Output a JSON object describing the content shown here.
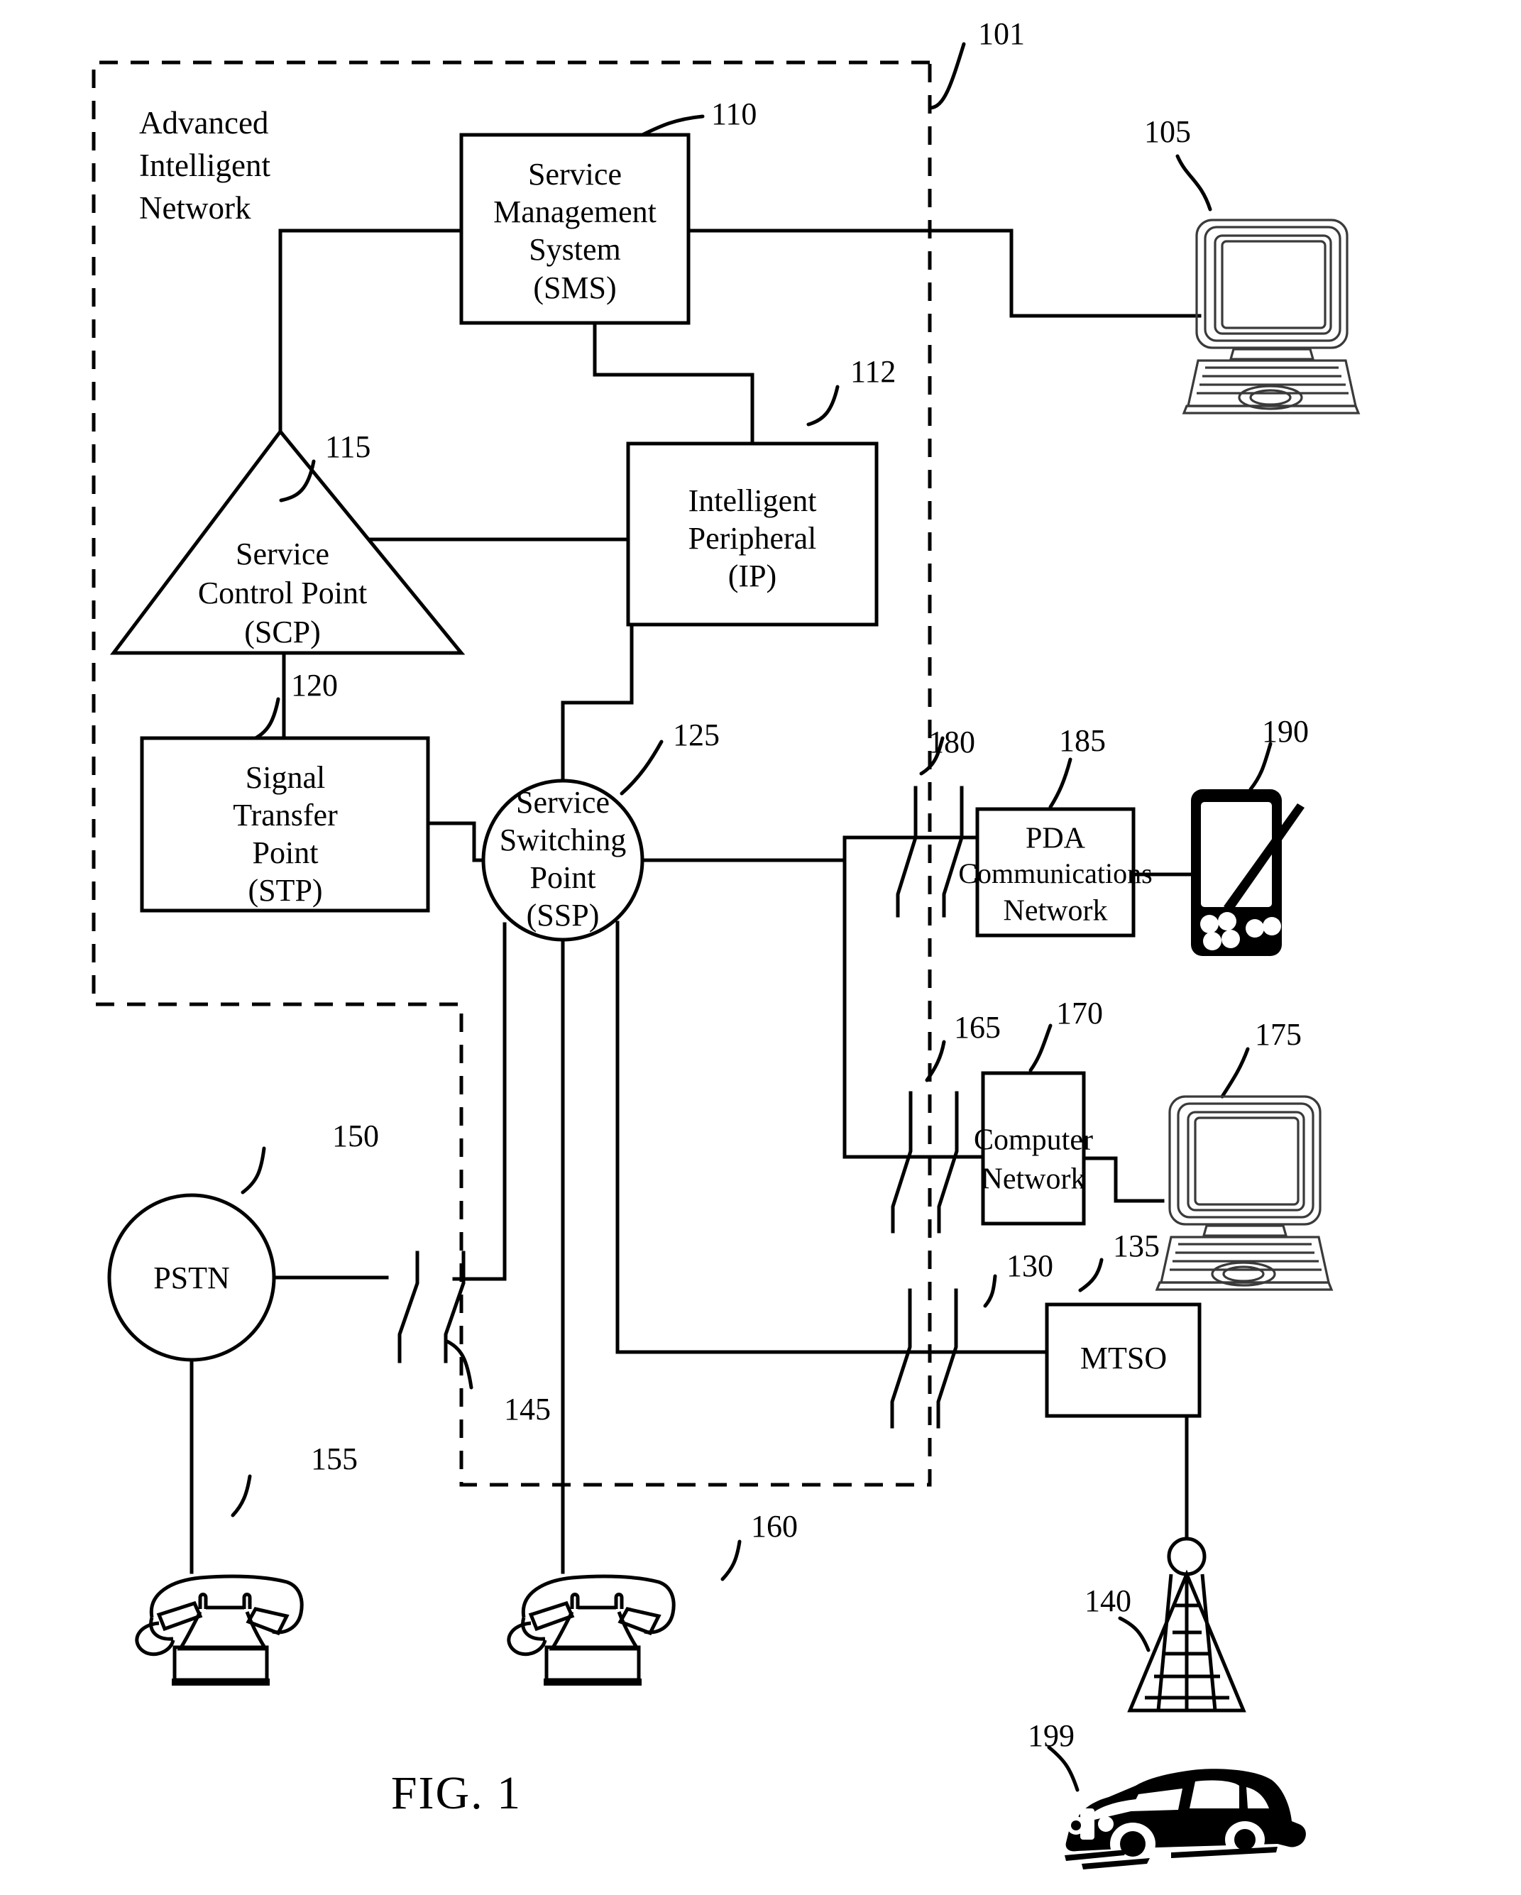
{
  "figure": {
    "caption": "FIG. 1",
    "boundary_label": "Advanced Intelligent Network",
    "boundary_label_lines": [
      "Advanced",
      "Intelligent",
      "Network"
    ],
    "boundary_ref": "101"
  },
  "nodes": {
    "sms": {
      "ref": "110",
      "shape": "rectangle",
      "lines": [
        "Service",
        "Management",
        "System",
        "(SMS)"
      ]
    },
    "ip": {
      "ref": "112",
      "shape": "rectangle",
      "lines": [
        "Intelligent",
        "Peripheral",
        "(IP)"
      ]
    },
    "scp": {
      "ref": "115",
      "shape": "triangle",
      "lines": [
        "Service",
        "Control Point",
        "(SCP)"
      ]
    },
    "stp": {
      "ref": "120",
      "shape": "rectangle",
      "lines": [
        "Signal",
        "Transfer",
        "Point",
        "(STP)"
      ]
    },
    "ssp": {
      "ref": "125",
      "shape": "circle",
      "lines": [
        "Service",
        "Switching",
        "Point",
        "(SSP)"
      ]
    },
    "pstn": {
      "ref": "150",
      "shape": "circle",
      "lines": [
        "PSTN"
      ]
    },
    "mtso": {
      "ref": "135",
      "shape": "rectangle",
      "lines": [
        "MTSO"
      ]
    },
    "pda_network": {
      "ref": "185",
      "shape": "rectangle",
      "lines": [
        "PDA",
        "Communications",
        "Network"
      ]
    },
    "computer_network": {
      "ref": "170",
      "shape": "rectangle",
      "lines": [
        "Computer",
        "Network"
      ]
    }
  },
  "devices": {
    "computer_105": {
      "ref": "105",
      "kind": "desktop-computer"
    },
    "pda_190": {
      "ref": "190",
      "kind": "pda-handheld"
    },
    "computer_175": {
      "ref": "175",
      "kind": "desktop-computer"
    },
    "tower_140": {
      "ref": "140",
      "kind": "cell-tower"
    },
    "car_199": {
      "ref": "199",
      "kind": "automobile"
    },
    "phone_155": {
      "ref": "155",
      "kind": "desk-telephone"
    },
    "phone_160": {
      "ref": "160",
      "kind": "desk-telephone"
    }
  },
  "trunk_refs": {
    "pda_trunk": "180",
    "computer_trunk": "165",
    "mtso_trunk": "130",
    "pstn_trunk": "145"
  }
}
